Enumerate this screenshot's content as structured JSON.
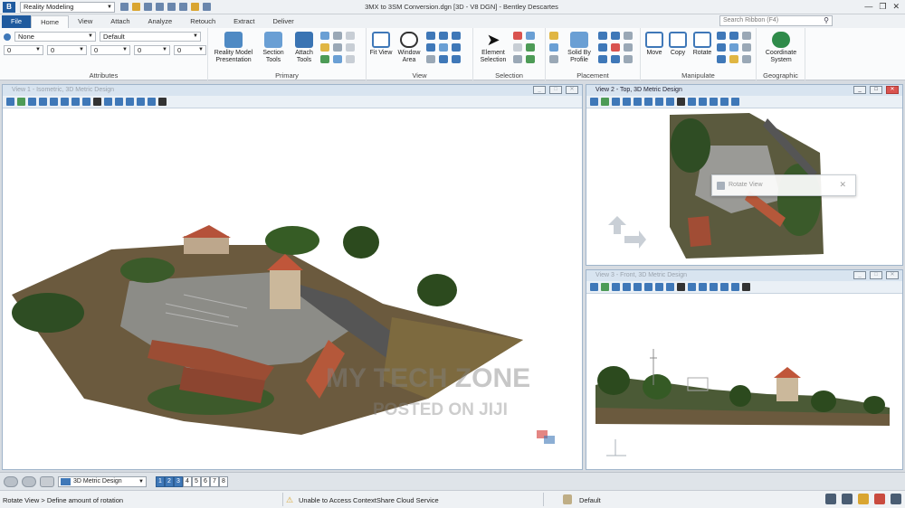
{
  "app": {
    "workflow": "Reality Modeling",
    "window_title": "3MX to 3SM Conversion.dgn [3D - V8 DGN] - Bentley Descartes"
  },
  "tabs": [
    "File",
    "Home",
    "View",
    "Attach",
    "Analyze",
    "Retouch",
    "Extract",
    "Deliver"
  ],
  "active_tab": "Home",
  "search": {
    "placeholder": "Search Ribbon (F4)"
  },
  "ribbon": {
    "attributes": {
      "label": "Attributes",
      "level_value": "None",
      "style_value": "Default",
      "color_value": "0",
      "linestyle_value": "0",
      "weight_value": "0",
      "transparency_value": "0",
      "priority_value": "0"
    },
    "primary": {
      "label": "Primary",
      "reality_model_presentation": "Reality Model Presentation",
      "section_tools": "Section Tools",
      "attach_tools": "Attach Tools"
    },
    "view": {
      "label": "View",
      "fit_view": "Fit View",
      "window_area": "Window Area"
    },
    "selection": {
      "label": "Selection",
      "element_selection": "Element Selection"
    },
    "placement": {
      "label": "Placement",
      "solid_by_profile": "Solid By Profile"
    },
    "manipulate": {
      "label": "Manipulate",
      "move": "Move",
      "copy": "Copy",
      "rotate": "Rotate"
    },
    "geographic": {
      "label": "Geographic",
      "coordinate_system": "Coordinate System"
    }
  },
  "views": {
    "view1": {
      "title": "View 1 - Isometric, 3D Metric Design"
    },
    "view2": {
      "title": "View 2 - Top, 3D Metric Design"
    },
    "view3": {
      "title": "View 3 - Front, 3D Metric Design"
    }
  },
  "rotate_dialog": {
    "title": "Rotate View"
  },
  "watermark": {
    "line1": "MY TECH ZONE",
    "line2": "POSTED ON JIJI"
  },
  "viewbar": {
    "model": "3D Metric Design",
    "view_numbers": [
      "1",
      "2",
      "3",
      "4",
      "5",
      "6",
      "7",
      "8"
    ],
    "active_views": [
      "1",
      "2",
      "3"
    ]
  },
  "status": {
    "prompt": "Rotate View > Define amount of rotation",
    "message": "Unable to Access ContextShare Cloud Service",
    "level": "Default"
  }
}
